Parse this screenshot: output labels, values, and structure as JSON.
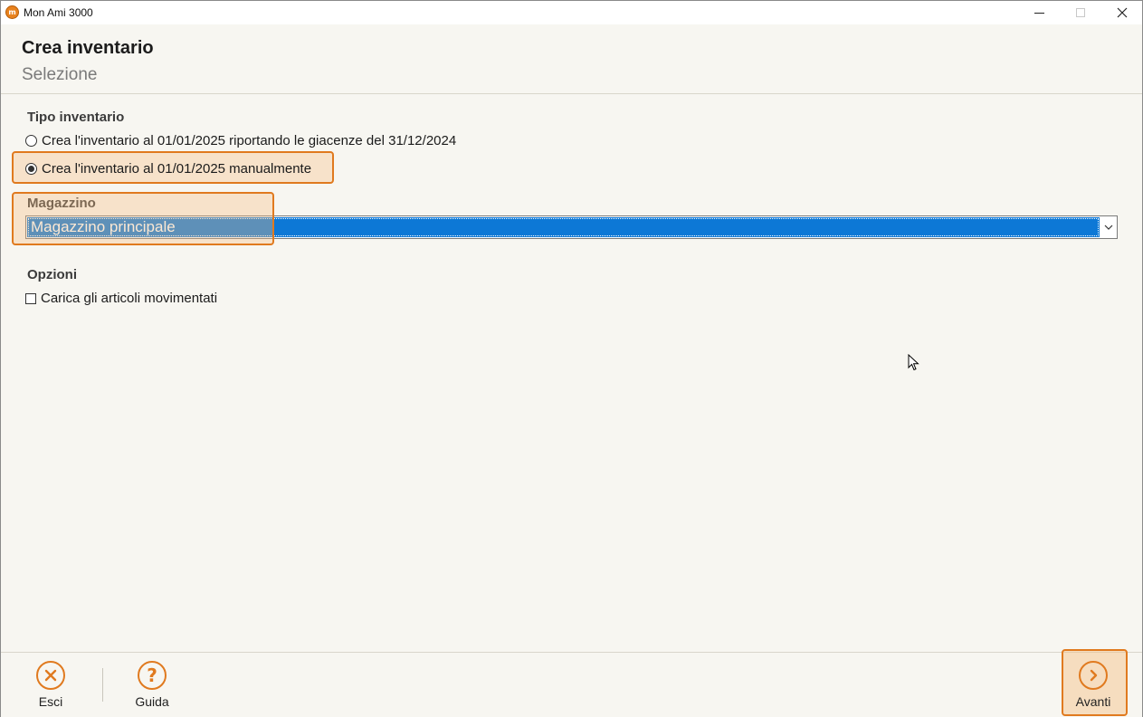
{
  "window": {
    "app_title": "Mon Ami 3000",
    "app_icon": "mon-ami-logo-icon"
  },
  "header": {
    "title": "Crea inventario",
    "subtitle": "Selezione"
  },
  "tipo_inventario": {
    "label": "Tipo inventario",
    "options": [
      {
        "label": "Crea l'inventario al 01/01/2025 riportando le giacenze del 31/12/2024",
        "selected": false
      },
      {
        "label": "Crea l'inventario al 01/01/2025 manualmente",
        "selected": true
      }
    ]
  },
  "magazzino": {
    "label": "Magazzino",
    "selected_value": "Magazzino principale"
  },
  "opzioni": {
    "label": "Opzioni",
    "checkbox_label": "Carica gli articoli movimentati",
    "checked": false
  },
  "footer": {
    "esci_label": "Esci",
    "guida_label": "Guida",
    "avanti_label": "Avanti"
  },
  "colors": {
    "accent": "#e07a1f",
    "selection": "#0d78d6",
    "background": "#f7f6f1"
  }
}
